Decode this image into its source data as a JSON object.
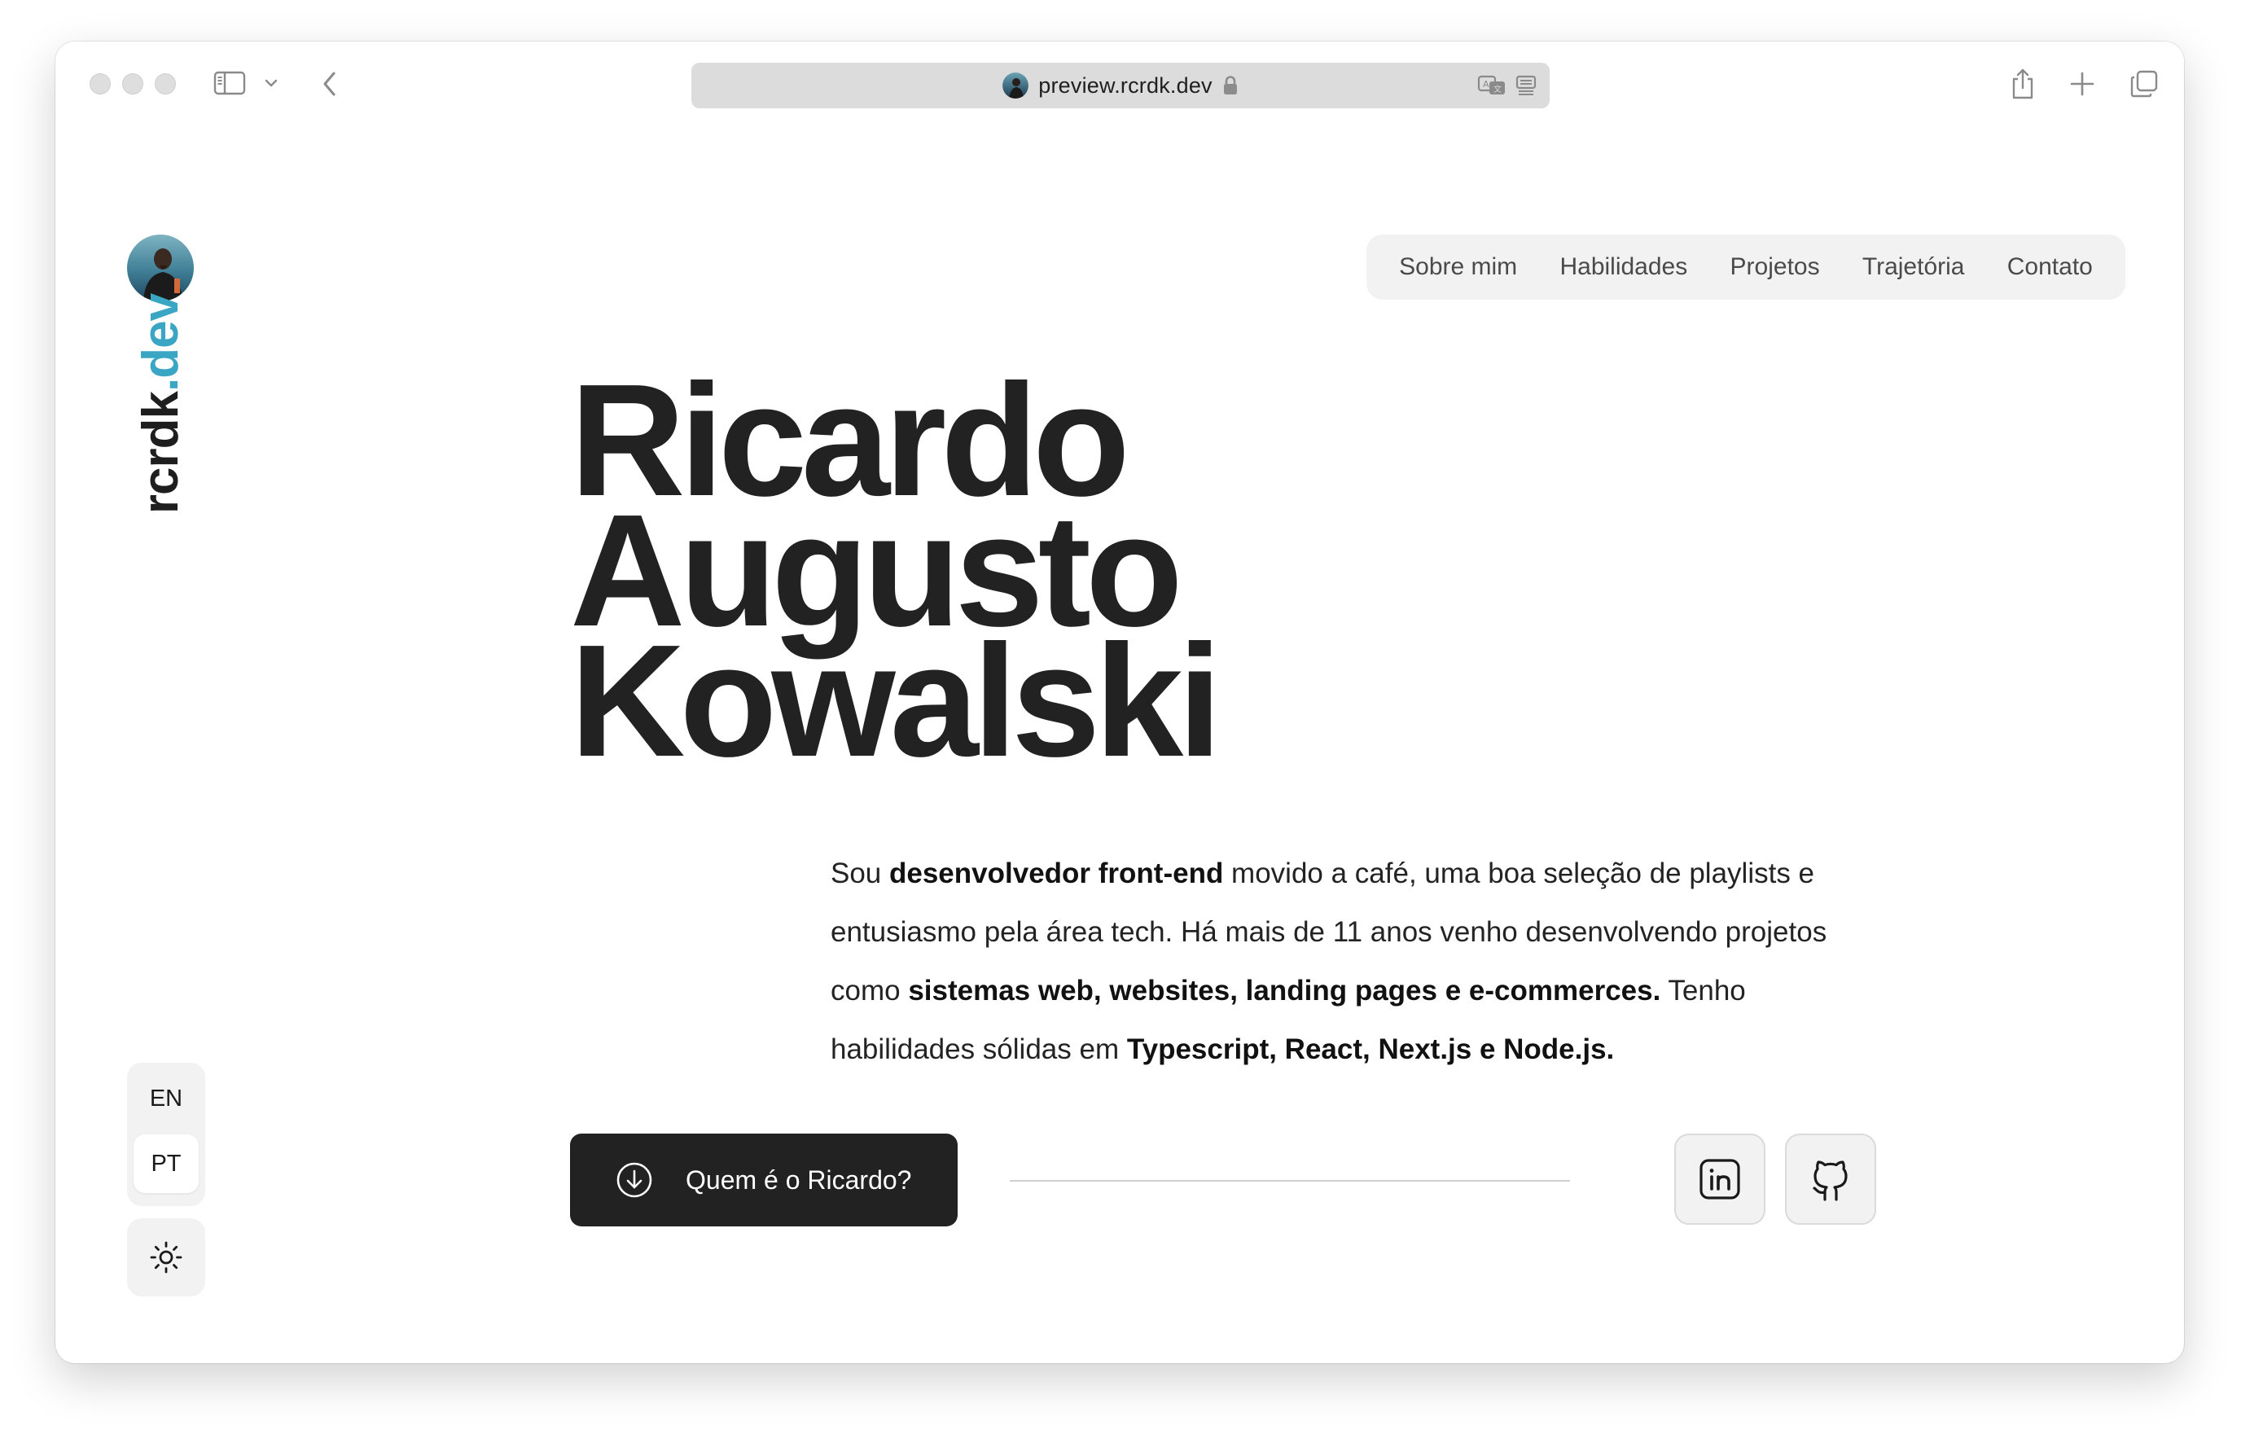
{
  "browser": {
    "url": "preview.rcrdk.dev",
    "icons": {
      "sidebar": "sidebar-icon",
      "tab_overview_chevron": "chevron-down-icon",
      "back": "chevron-left-icon",
      "secure": "lock-icon",
      "translate": "translate-icon",
      "reader": "reader-icon",
      "share": "share-icon",
      "new_tab": "plus-icon",
      "tabs": "tabs-overview-icon"
    }
  },
  "brand": {
    "part1": "rcrdk",
    "part2": ".dev",
    "accent_color": "#3aa6c4"
  },
  "nav": {
    "items": [
      {
        "label": "Sobre mim"
      },
      {
        "label": "Habilidades"
      },
      {
        "label": "Projetos"
      },
      {
        "label": "Trajetória"
      },
      {
        "label": "Contato"
      }
    ]
  },
  "hero": {
    "name_lines": [
      "Ricardo",
      "Augusto",
      "Kowalski"
    ],
    "intro": {
      "p1": "Sou ",
      "b1": "desenvolvedor front-end",
      "p2": " movido a café, uma boa seleção de playlists e entusiasmo pela área tech. Há mais de 11 anos venho desenvolvendo projetos como ",
      "b2": "sistemas web, websites, landing pages e e-commerces.",
      "p3": " Tenho habilidades sólidas em ",
      "b3": "Typescript, React, Next.js e Node.js."
    },
    "cta_label": "Quem é o Ricardo?",
    "cta_icon": "arrow-down-circle-icon"
  },
  "social": {
    "linkedin_icon": "linkedin-icon",
    "github_icon": "github-icon"
  },
  "language": {
    "options": [
      "EN",
      "PT"
    ],
    "selected": "PT"
  },
  "theme": {
    "icon": "sun-icon"
  },
  "colors": {
    "text_dark": "#222222",
    "surface": "#f2f2f2",
    "cta_background": "#222222"
  }
}
